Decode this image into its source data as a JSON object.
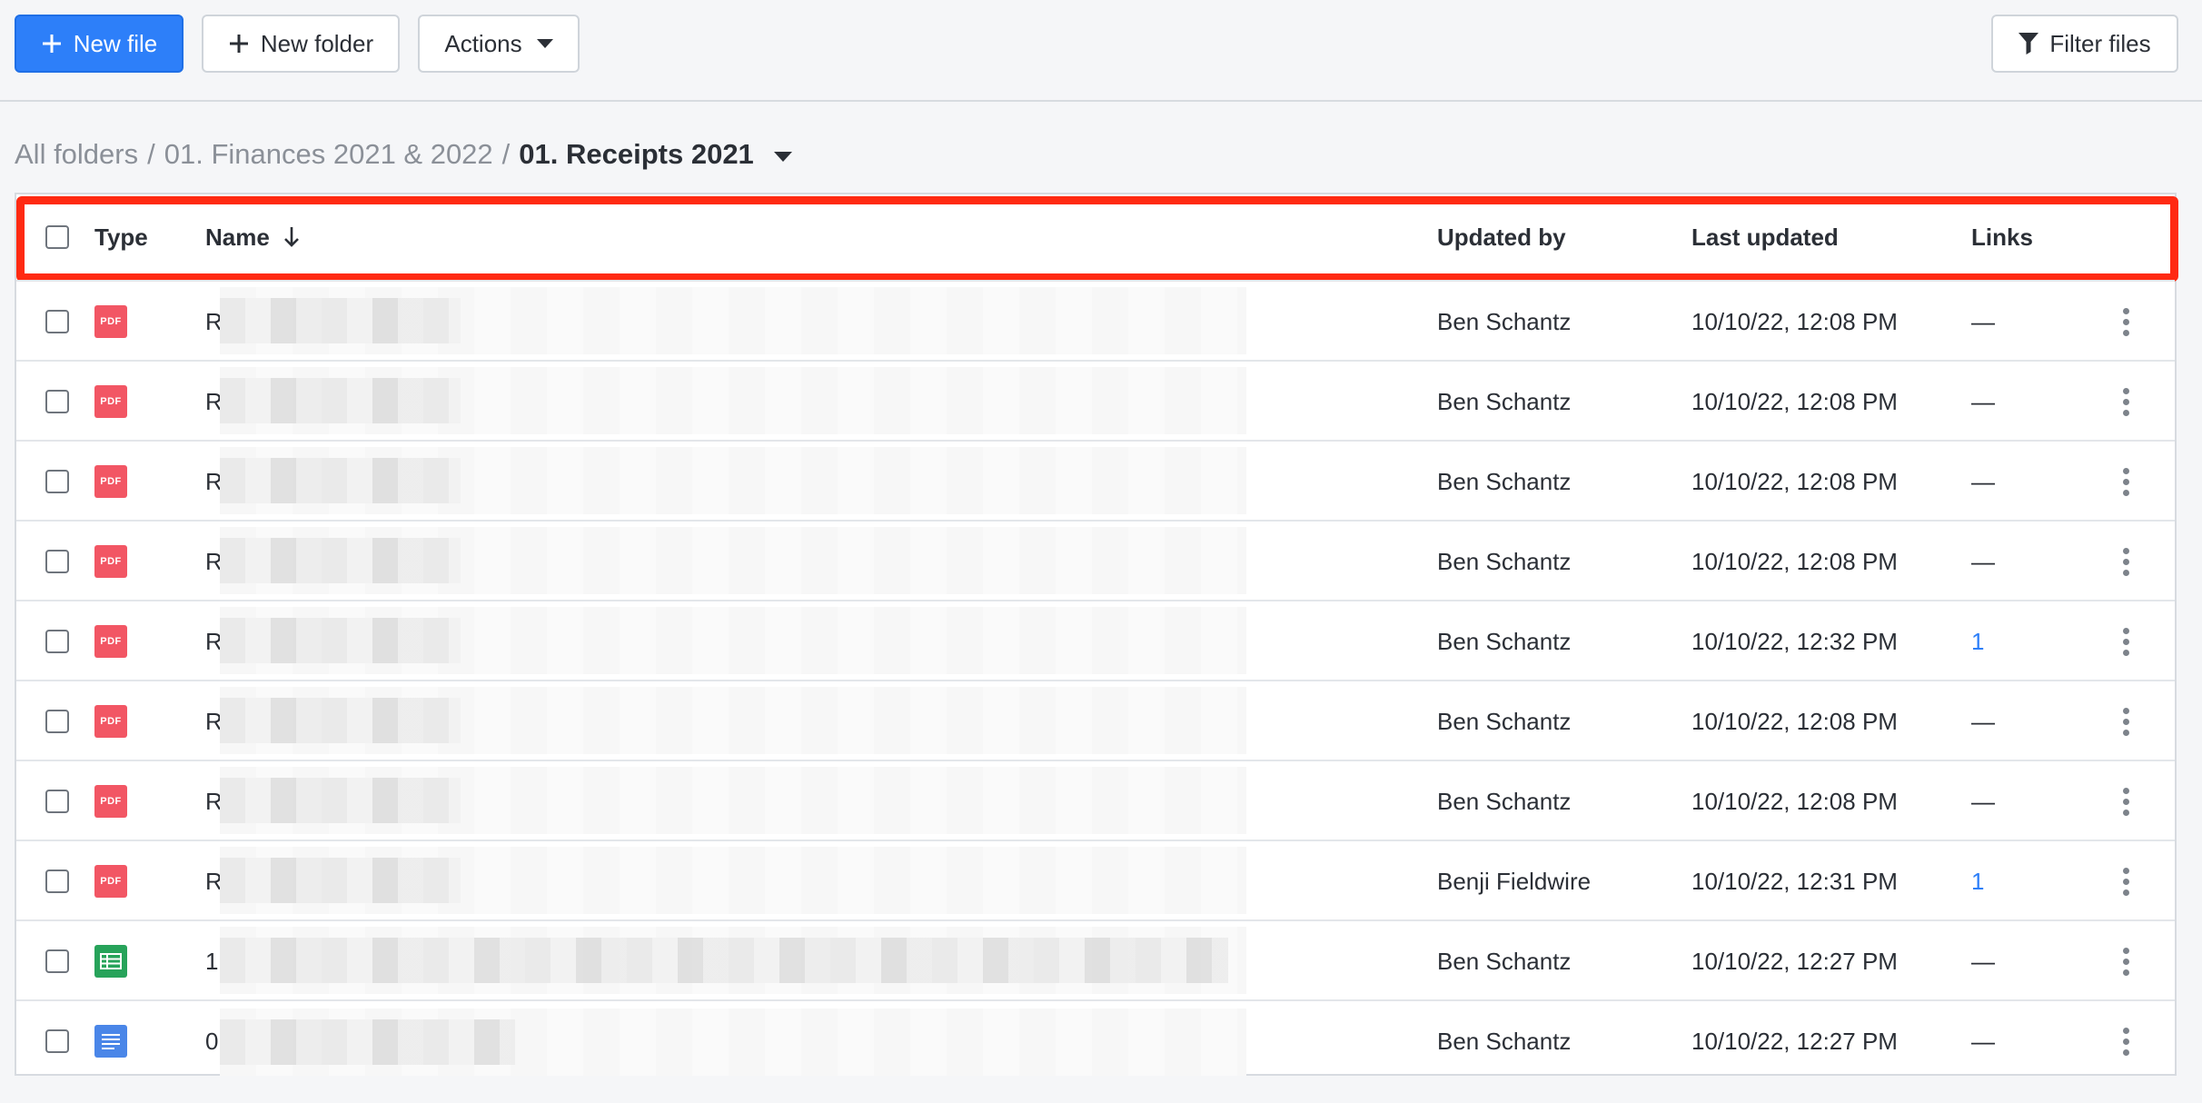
{
  "toolbar": {
    "new_file": "New file",
    "new_folder": "New folder",
    "actions": "Actions",
    "filter": "Filter files"
  },
  "breadcrumb": {
    "items": [
      "All folders",
      "01. Finances 2021 & 2022"
    ],
    "separator": "/",
    "current": "01. Receipts 2021"
  },
  "table": {
    "headers": {
      "type": "Type",
      "name": "Name",
      "updated_by": "Updated by",
      "last_updated": "Last updated",
      "links": "Links"
    },
    "rows": [
      {
        "type": "pdf",
        "type_label": "PDF",
        "name": "R",
        "updated_by": "Ben Schantz",
        "last_updated": "10/10/22, 12:08 PM",
        "links": "—"
      },
      {
        "type": "pdf",
        "type_label": "PDF",
        "name": "R",
        "updated_by": "Ben Schantz",
        "last_updated": "10/10/22, 12:08 PM",
        "links": "—"
      },
      {
        "type": "pdf",
        "type_label": "PDF",
        "name": "R",
        "updated_by": "Ben Schantz",
        "last_updated": "10/10/22, 12:08 PM",
        "links": "—"
      },
      {
        "type": "pdf",
        "type_label": "PDF",
        "name": "R",
        "updated_by": "Ben Schantz",
        "last_updated": "10/10/22, 12:08 PM",
        "links": "—"
      },
      {
        "type": "pdf",
        "type_label": "PDF",
        "name": "R",
        "updated_by": "Ben Schantz",
        "last_updated": "10/10/22, 12:32 PM",
        "links": "1"
      },
      {
        "type": "pdf",
        "type_label": "PDF",
        "name": "R",
        "updated_by": "Ben Schantz",
        "last_updated": "10/10/22, 12:08 PM",
        "links": "—"
      },
      {
        "type": "pdf",
        "type_label": "PDF",
        "name": "R",
        "updated_by": "Ben Schantz",
        "last_updated": "10/10/22, 12:08 PM",
        "links": "—"
      },
      {
        "type": "pdf",
        "type_label": "PDF",
        "name": "R",
        "updated_by": "Benji Fieldwire",
        "last_updated": "10/10/22, 12:31 PM",
        "links": "1"
      },
      {
        "type": "spreadsheet",
        "name": "1",
        "updated_by": "Ben Schantz",
        "last_updated": "10/10/22, 12:27 PM",
        "links": "—"
      },
      {
        "type": "document",
        "name": "0",
        "updated_by": "Ben Schantz",
        "last_updated": "10/10/22, 12:27 PM",
        "links": "—"
      }
    ]
  },
  "colors": {
    "primary": "#2d7ff9",
    "highlight": "#ff2a12",
    "pdf": "#f25664",
    "spreadsheet": "#27a35a",
    "document": "#4a86e8"
  }
}
